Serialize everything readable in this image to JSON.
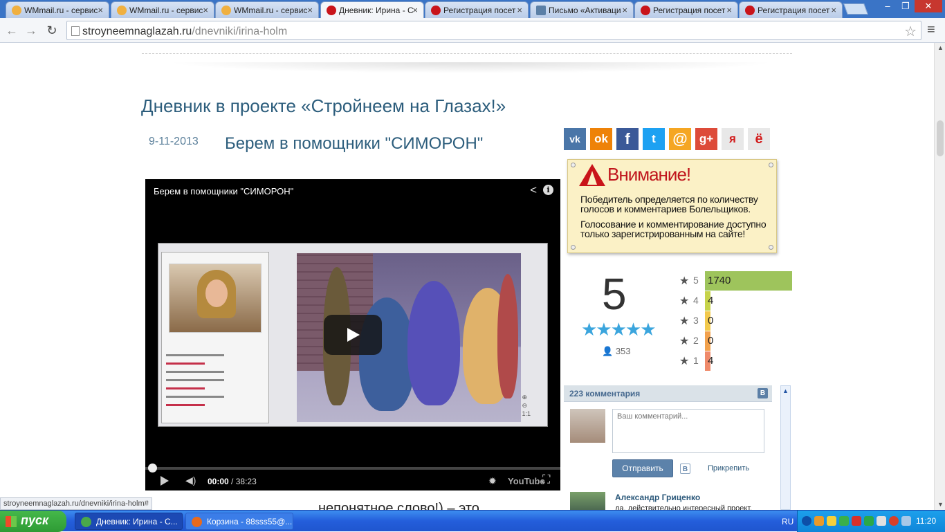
{
  "browser": {
    "tabs": [
      {
        "title": "WMmail.ru - сервис",
        "favicon": "wmmail-icon",
        "color": "#f0b040"
      },
      {
        "title": "WMmail.ru - сервис",
        "favicon": "wmmail-icon",
        "color": "#f0b040"
      },
      {
        "title": "WMmail.ru - сервис",
        "favicon": "wmmail-icon",
        "color": "#f0b040"
      },
      {
        "title": "Дневник: Ирина - С",
        "favicon": "maple-leaf-icon",
        "color": "#c9141a",
        "active": true
      },
      {
        "title": "Регистрация посет",
        "favicon": "maple-leaf-icon",
        "color": "#c9141a"
      },
      {
        "title": "Письмо «Активаци",
        "favicon": "mail-icon",
        "color": "#5b7fa6"
      },
      {
        "title": "Регистрация посет",
        "favicon": "maple-leaf-icon",
        "color": "#c9141a"
      },
      {
        "title": "Регистрация посет",
        "favicon": "maple-leaf-icon",
        "color": "#c9141a"
      }
    ],
    "url_host": "stroyneemnaglazah.ru",
    "url_path": "/dnevniki/irina-holm",
    "status_url": "stroyneemnaglazah.ru/dnevniki/irina-holm#"
  },
  "page": {
    "title": "Дневник в проекте «Стройнеем на Глазах!»",
    "post_date": "9-11-2013",
    "post_title": "Берем в помощники \"СИМОРОН\"",
    "post_text": "непонятное слово!) – это"
  },
  "video": {
    "title": "Берем в помощники \"СИМОРОН\"",
    "current_time": "00:00",
    "duration": "/ 38:23",
    "brand": "YouTube",
    "progress": 0.0
  },
  "social": [
    {
      "name": "vk-icon",
      "label": "vk",
      "color": "#4a76a8"
    },
    {
      "name": "odnoklassniki-icon",
      "label": "ok",
      "color": "#ee8208"
    },
    {
      "name": "facebook-icon",
      "label": "f",
      "color": "#3b5998"
    },
    {
      "name": "twitter-icon",
      "label": "t",
      "color": "#1da1f2"
    },
    {
      "name": "mailru-icon",
      "label": "@",
      "color": "#f5a623"
    },
    {
      "name": "google-plus-icon",
      "label": "g+",
      "color": "#dd4b39"
    },
    {
      "name": "yandex-icon",
      "label": "я",
      "color": "#e8e8e8"
    },
    {
      "name": "liveinternet-icon",
      "label": "ё",
      "color": "#e8e8e8"
    }
  ],
  "attention": {
    "heading": "Внимание!",
    "text1": "Победитель определяется по количеству голосов и комментариев Болельщиков.",
    "text2": "Голосование и комментирование доступно только зарегистрированным на сайте!"
  },
  "rating": {
    "score": "5",
    "stars": "★★★★★",
    "votes": "353",
    "distribution": [
      {
        "stars": "5",
        "count": "1740",
        "color": "#9ec45c"
      },
      {
        "stars": "4",
        "count": "4",
        "color": "#c6d34a"
      },
      {
        "stars": "3",
        "count": "0",
        "color": "#f2c94c"
      },
      {
        "stars": "2",
        "count": "0",
        "color": "#f2a14c"
      },
      {
        "stars": "1",
        "count": "4",
        "color": "#ef8a6a"
      }
    ]
  },
  "comments": {
    "count_label": "223 комментария",
    "placeholder": "Ваш комментарий...",
    "send_label": "Отправить",
    "attach_label": "Прикрепить",
    "first_author": "Александр Гриценко",
    "first_text": "да, действительно интересный проект,"
  },
  "taskbar": {
    "start_label": "пуск",
    "items": [
      {
        "label": "Дневник: Ирина - С...",
        "color": "#4aa84a"
      },
      {
        "label": "Корзина - 88sss55@...",
        "color": "#e86a1c"
      }
    ],
    "language": "RU",
    "clock": "11:20"
  }
}
